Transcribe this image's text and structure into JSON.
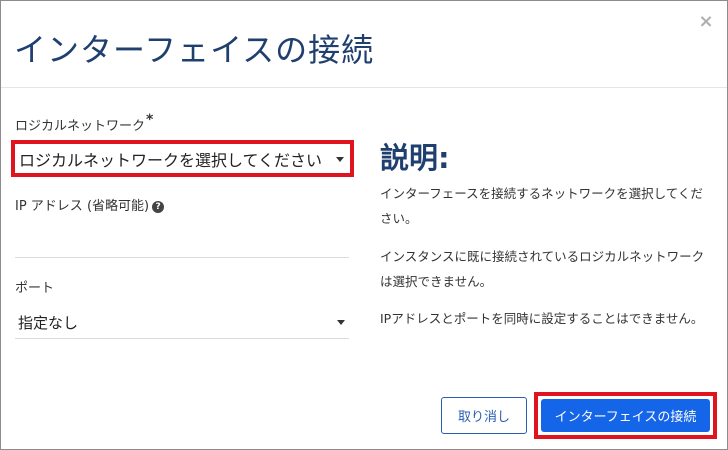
{
  "dialog": {
    "title": "インターフェイスの接続",
    "close_symbol": "×"
  },
  "form": {
    "network": {
      "label": "ロジカルネットワーク",
      "required_mark": "*",
      "selected": "ロジカルネットワークを選択してください"
    },
    "ip_address": {
      "label": "IP アドレス (省略可能)",
      "help_symbol": "?",
      "value": ""
    },
    "port": {
      "label": "ポート",
      "selected": "指定なし"
    }
  },
  "description": {
    "title": "説明:",
    "paragraphs": [
      "インターフェースを接続するネットワークを選択してください。",
      "インスタンスに既に接続されているロジカルネットワークは選択できません。",
      "IPアドレスとポートを同時に設定することはできません。"
    ]
  },
  "footer": {
    "cancel_label": "取り消し",
    "connect_label": "インターフェイスの接続"
  },
  "colors": {
    "accent": "#1565e8",
    "title": "#1f3f6e",
    "highlight": "#e0141e"
  },
  "icons": {
    "close": "close-icon",
    "help": "help-icon",
    "dropdown": "chevron-down-icon"
  }
}
